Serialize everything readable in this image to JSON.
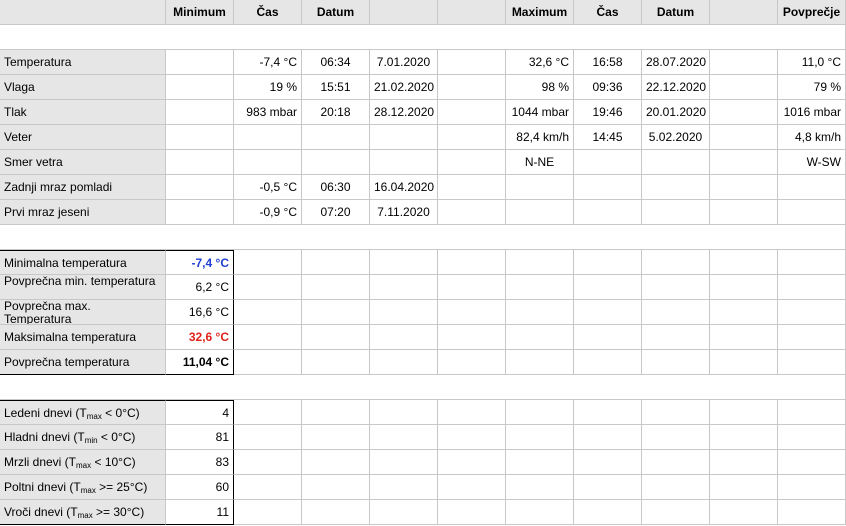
{
  "headers": {
    "minimum": "Minimum",
    "cas1": "Čas",
    "datum1": "Datum",
    "maximum": "Maximum",
    "cas2": "Čas",
    "datum2": "Datum",
    "povprecje": "Povprečje"
  },
  "rows": [
    {
      "label": "Temperatura",
      "min": "-7,4 °C",
      "min_time": "06:34",
      "min_date": "7.01.2020",
      "max": "32,6 °C",
      "max_time": "16:58",
      "max_date": "28.07.2020",
      "avg": "11,0 °C"
    },
    {
      "label": "Vlaga",
      "min": "19 %",
      "min_time": "15:51",
      "min_date": "21.02.2020",
      "max": "98 %",
      "max_time": "09:36",
      "max_date": "22.12.2020",
      "avg": "79 %"
    },
    {
      "label": "Tlak",
      "min": "983 mbar",
      "min_time": "20:18",
      "min_date": "28.12.2020",
      "max": "1044 mbar",
      "max_time": "19:46",
      "max_date": "20.01.2020",
      "avg": "1016 mbar"
    },
    {
      "label": "Veter",
      "min": "",
      "min_time": "",
      "min_date": "",
      "max": "82,4 km/h",
      "max_time": "14:45",
      "max_date": "5.02.2020",
      "avg": "4,8 km/h"
    },
    {
      "label": "Smer vetra",
      "min": "",
      "min_time": "",
      "min_date": "",
      "max": "N-NE",
      "max_time": "",
      "max_date": "",
      "avg": "W-SW"
    },
    {
      "label": "Zadnji mraz pomladi",
      "min": "-0,5 °C",
      "min_time": "06:30",
      "min_date": "16.04.2020",
      "max": "",
      "max_time": "",
      "max_date": "",
      "avg": ""
    },
    {
      "label": "Prvi mraz jeseni",
      "min": "-0,9 °C",
      "min_time": "07:20",
      "min_date": "7.11.2020",
      "max": "",
      "max_time": "",
      "max_date": "",
      "avg": ""
    }
  ],
  "summary": [
    {
      "label": "Minimalna temperatura",
      "value": "-7,4 °C",
      "style": "blue"
    },
    {
      "label": "Povprečna min. temperatura",
      "value": "6,2 °C",
      "style": ""
    },
    {
      "label": "Povprečna max. Temperatura",
      "value": "16,6 °C",
      "style": ""
    },
    {
      "label": "Maksimalna temperatura",
      "value": "32,6 °C",
      "style": "red"
    },
    {
      "label": "Povprečna temperatura",
      "value": "11,04 °C",
      "style": "bold"
    }
  ],
  "days": [
    {
      "pre": "Ledeni dnevi (T",
      "sub": "max",
      "post": " < 0°C)",
      "value": "4"
    },
    {
      "pre": "Hladni dnevi (T",
      "sub": "min",
      "post": " < 0°C)",
      "value": "81"
    },
    {
      "pre": "Mrzli dnevi (T",
      "sub": "max",
      "post": " < 10°C)",
      "value": "83"
    },
    {
      "pre": "Poltni dnevi (T",
      "sub": "max",
      "post": " >= 25°C)",
      "value": "60"
    },
    {
      "pre": "Vroči dnevi (T",
      "sub": "max",
      "post": " >= 30°C)",
      "value": "11"
    }
  ]
}
